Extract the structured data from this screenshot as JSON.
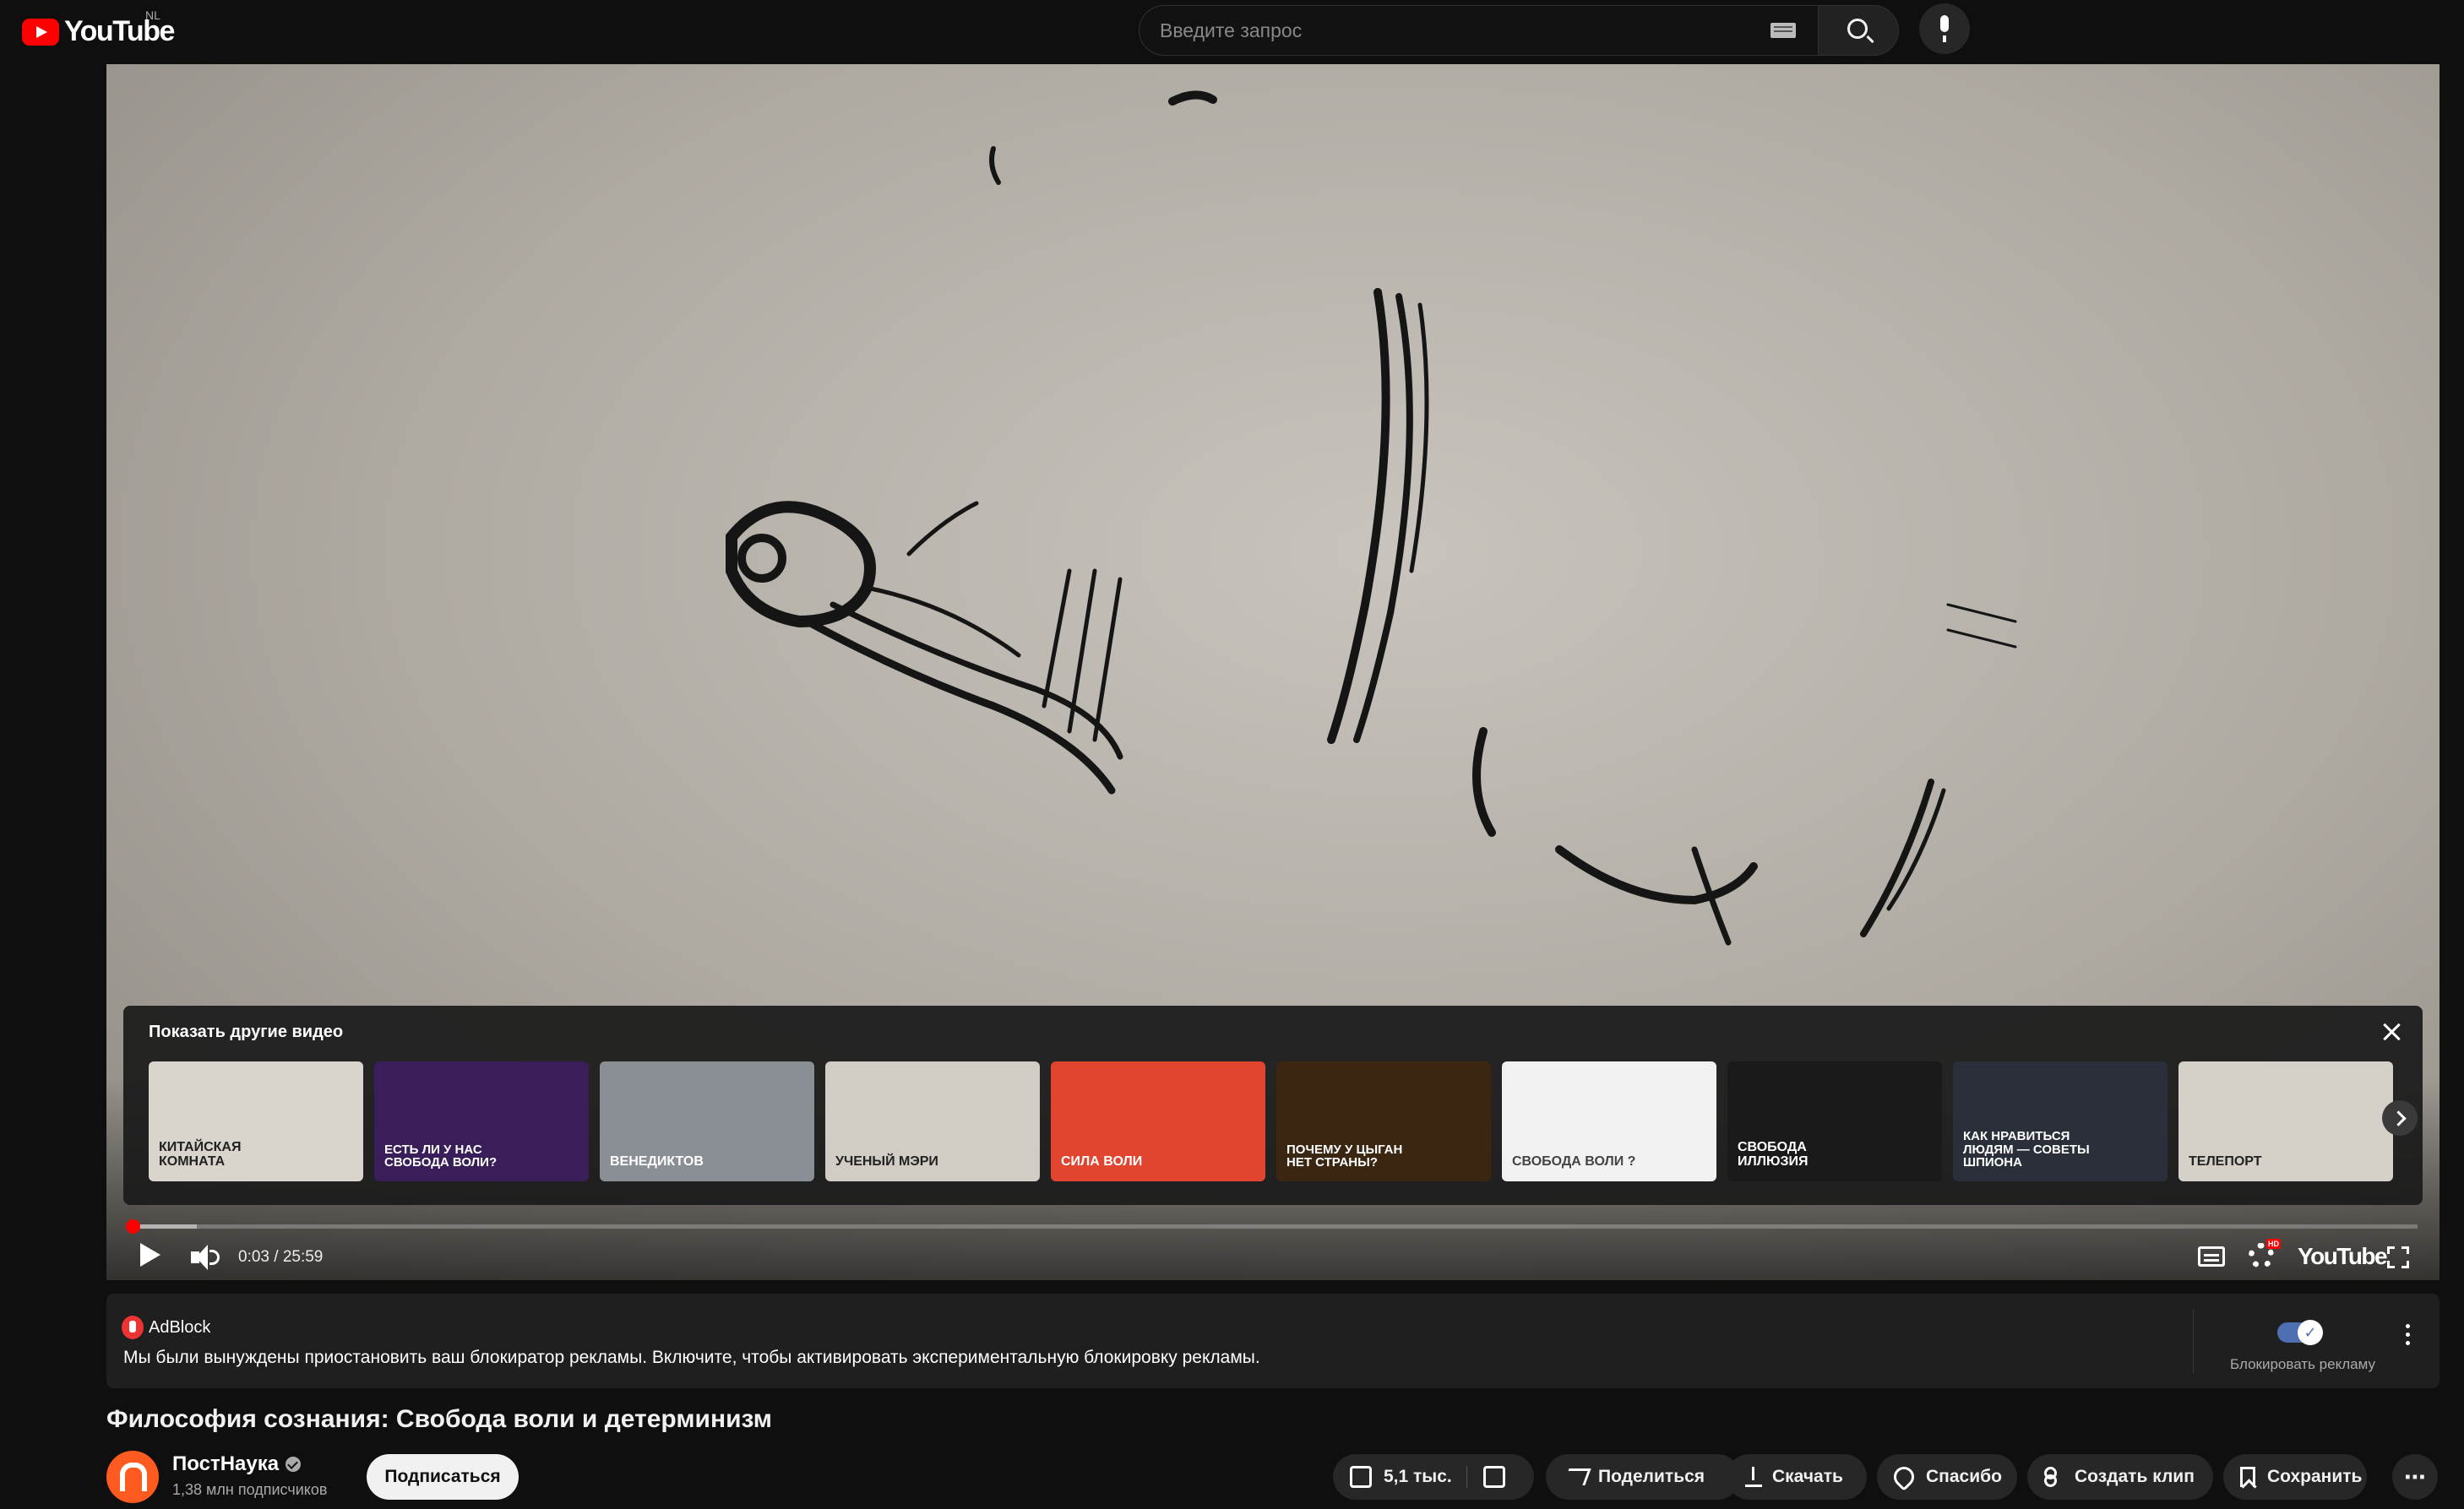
{
  "header": {
    "logo_text": "YouTube",
    "region": "NL",
    "search_placeholder": "Введите запрос"
  },
  "player": {
    "more_videos": {
      "title": "Показать другие видео",
      "thumbnails": [
        {
          "text": "Китайская комната",
          "bg": "#d9d4cc",
          "fg": "#222"
        },
        {
          "text": "Есть ли у нас свобода воли?",
          "bg": "#3a1e5a",
          "fg": "#fff"
        },
        {
          "text": "Венедиктов",
          "bg": "#8a8f95",
          "fg": "#fff"
        },
        {
          "text": "Ученый Мэри",
          "bg": "#d1ccc4",
          "fg": "#222"
        },
        {
          "text": "Сила воли",
          "bg": "#e2452f",
          "fg": "#fff"
        },
        {
          "text": "Почему у цыган нет страны?",
          "bg": "#3b2612",
          "fg": "#fff"
        },
        {
          "text": "Свобода воли ?",
          "bg": "#f2f2f2",
          "fg": "#444"
        },
        {
          "text": "Свобода иллюзия",
          "bg": "#1a1a1a",
          "fg": "#fff"
        },
        {
          "text": "Как нравиться людям — советы шпиона",
          "bg": "#2a2f3a",
          "fg": "#fff"
        },
        {
          "text": "Телепорт",
          "bg": "#d5d0c8",
          "fg": "#222"
        }
      ]
    },
    "progress": {
      "played_fraction": 0.002,
      "loaded_fraction": 0.03
    },
    "time": "0:03 / 25:59",
    "brand": "YouTube"
  },
  "adblock": {
    "name": "AdBlock",
    "message": "Мы были вынуждены приостановить ваш блокиратор рекламы. Включите, чтобы активировать экспериментальную блокировку рекламы.",
    "toggle_label": "Блокировать рекламу"
  },
  "video": {
    "title": "Философия сознания: Свобода воли и детерминизм",
    "channel": "ПостНаука",
    "subscribers": "1,38 млн подписчиков",
    "subscribe_label": "Подписаться"
  },
  "actions": {
    "likes": "5,1 тыс.",
    "share": "Поделиться",
    "download": "Скачать",
    "thanks": "Спасибо",
    "clip": "Создать клип",
    "save": "Сохранить",
    "more": "⋯"
  },
  "colors": {
    "accent": "#ff0000",
    "toggle": "#4f6fb3"
  }
}
